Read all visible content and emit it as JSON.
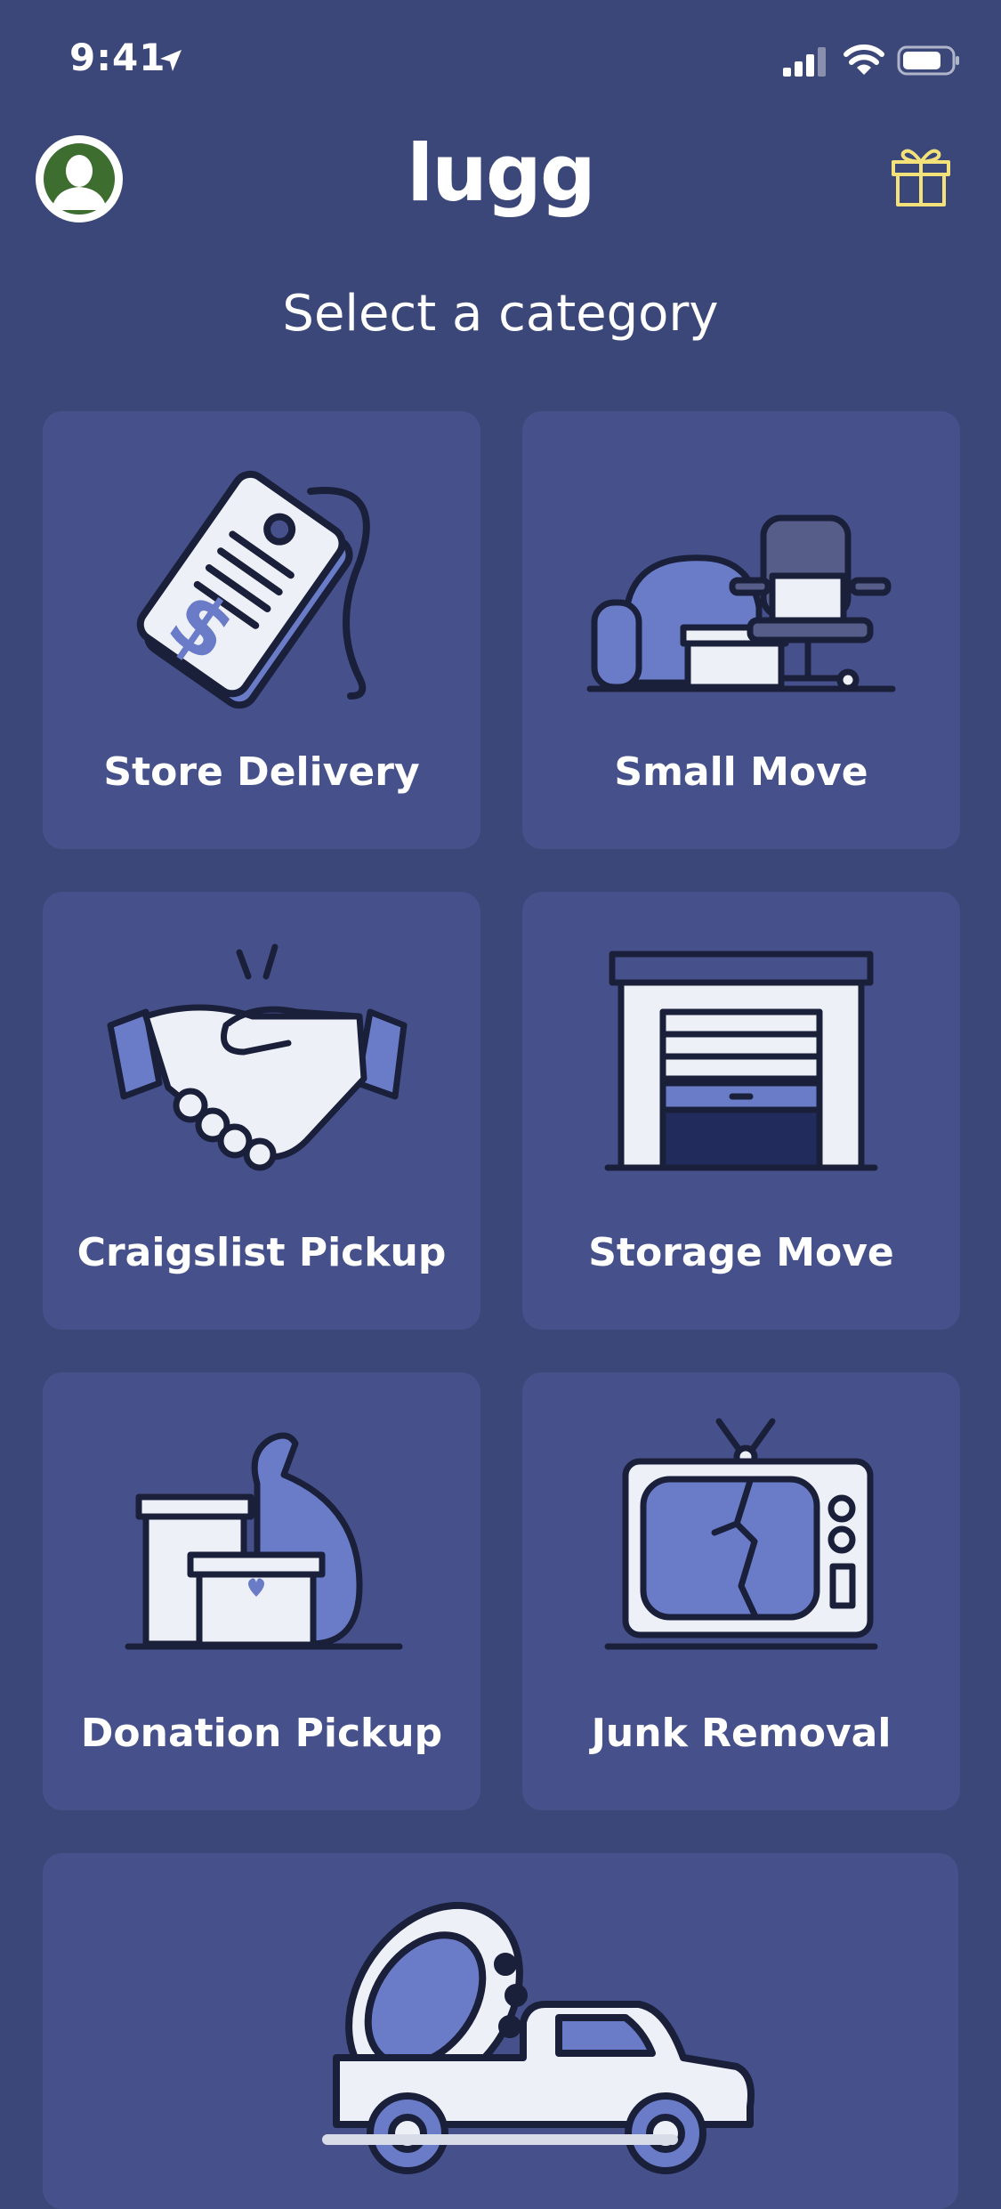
{
  "status_bar": {
    "time": "9:41"
  },
  "header": {
    "logo": "lugg"
  },
  "main": {
    "heading": "Select a category",
    "categories": [
      {
        "label": "Store Delivery"
      },
      {
        "label": "Small Move"
      },
      {
        "label": "Craigslist Pickup"
      },
      {
        "label": "Storage Move"
      },
      {
        "label": "Donation Pickup"
      },
      {
        "label": "Junk Removal"
      },
      {
        "label": ""
      }
    ]
  },
  "colors": {
    "background": "#3b4679",
    "card": "#46518c",
    "accent": "#6a7cc8",
    "gift": "#f3e27a"
  },
  "icons": [
    "location-arrow-icon",
    "signal-icon",
    "wifi-icon",
    "battery-icon",
    "gift-icon",
    "avatar"
  ]
}
